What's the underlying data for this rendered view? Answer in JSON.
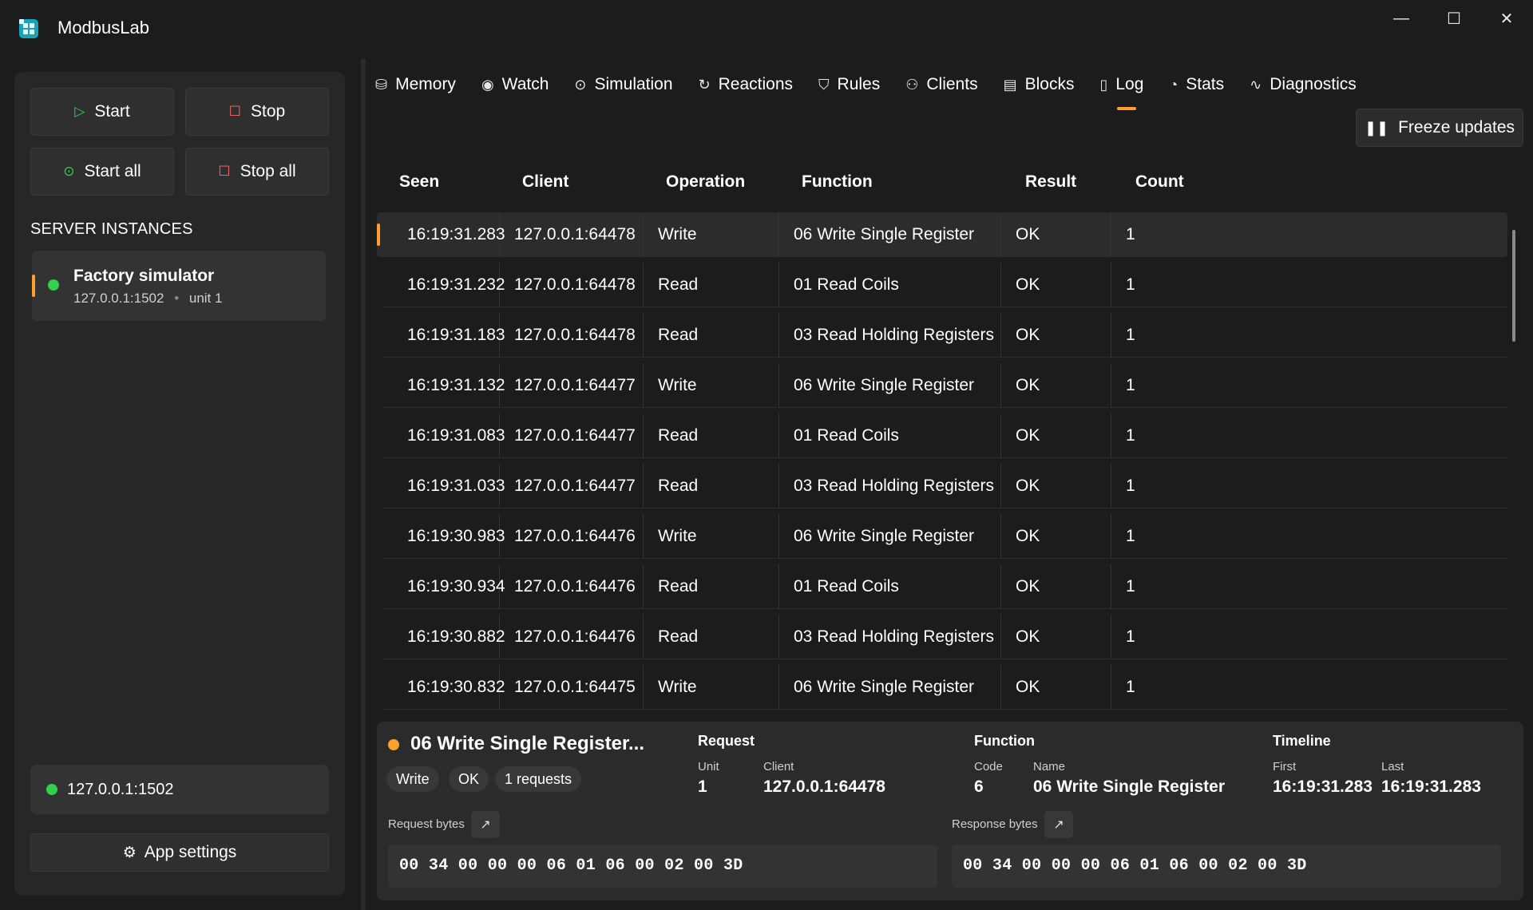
{
  "app": {
    "title": "ModbusLab",
    "window_controls": {
      "minimize": "—",
      "maximize": "☐",
      "close": "✕"
    }
  },
  "sidebar": {
    "buttons": {
      "start": "Start",
      "stop": "Stop",
      "start_all": "Start all",
      "stop_all": "Stop all"
    },
    "section_title": "SERVER INSTANCES",
    "instances": [
      {
        "name": "Factory simulator",
        "address": "127.0.0.1:1502",
        "unit": "unit 1",
        "status_color": "#2fd24a"
      }
    ],
    "status_address": "127.0.0.1:1502",
    "app_settings": "App settings"
  },
  "tabs": [
    {
      "label": "Memory",
      "icon": "database-icon"
    },
    {
      "label": "Watch",
      "icon": "eye-icon"
    },
    {
      "label": "Simulation",
      "icon": "play-circle-icon"
    },
    {
      "label": "Reactions",
      "icon": "refresh-icon"
    },
    {
      "label": "Rules",
      "icon": "shield-icon"
    },
    {
      "label": "Clients",
      "icon": "users-icon"
    },
    {
      "label": "Blocks",
      "icon": "blocks-icon"
    },
    {
      "label": "Log",
      "icon": "document-icon",
      "active": true
    },
    {
      "label": "Stats",
      "icon": "chart-icon"
    },
    {
      "label": "Diagnostics",
      "icon": "pulse-icon"
    }
  ],
  "freeze_updates": "Freeze updates",
  "table": {
    "columns": [
      "Seen",
      "Client",
      "Operation",
      "Function",
      "Result",
      "Count"
    ],
    "rows": [
      [
        "16:19:31.283",
        "127.0.0.1:64478",
        "Write",
        "06 Write Single Register",
        "OK",
        "1"
      ],
      [
        "16:19:31.232",
        "127.0.0.1:64478",
        "Read",
        "01 Read Coils",
        "OK",
        "1"
      ],
      [
        "16:19:31.183",
        "127.0.0.1:64478",
        "Read",
        "03 Read Holding Registers",
        "OK",
        "1"
      ],
      [
        "16:19:31.132",
        "127.0.0.1:64477",
        "Write",
        "06 Write Single Register",
        "OK",
        "1"
      ],
      [
        "16:19:31.083",
        "127.0.0.1:64477",
        "Read",
        "01 Read Coils",
        "OK",
        "1"
      ],
      [
        "16:19:31.033",
        "127.0.0.1:64477",
        "Read",
        "03 Read Holding Registers",
        "OK",
        "1"
      ],
      [
        "16:19:30.983",
        "127.0.0.1:64476",
        "Write",
        "06 Write Single Register",
        "OK",
        "1"
      ],
      [
        "16:19:30.934",
        "127.0.0.1:64476",
        "Read",
        "01 Read Coils",
        "OK",
        "1"
      ],
      [
        "16:19:30.882",
        "127.0.0.1:64476",
        "Read",
        "03 Read Holding Registers",
        "OK",
        "1"
      ],
      [
        "16:19:30.832",
        "127.0.0.1:64475",
        "Write",
        "06 Write Single Register",
        "OK",
        "1"
      ]
    ]
  },
  "details": {
    "title": "06 Write Single Register...",
    "chips": [
      "Write",
      "OK",
      "1 requests"
    ],
    "request": {
      "heading": "Request",
      "unit_label": "Unit",
      "unit": "1",
      "client_label": "Client",
      "client": "127.0.0.1:64478"
    },
    "function": {
      "heading": "Function",
      "code_label": "Code",
      "code": "6",
      "name_label": "Name",
      "name": "06 Write Single Register"
    },
    "timeline": {
      "heading": "Timeline",
      "first_label": "First",
      "first": "16:19:31.283",
      "last_label": "Last",
      "last": "16:19:31.283"
    },
    "request_bytes_label": "Request bytes",
    "request_bytes": "00 34 00 00 00 06 01 06 00 02 00 3D",
    "response_bytes_label": "Response bytes",
    "response_bytes": "00 34 00 00 00 06 01 06 00 02 00 3D"
  },
  "colors": {
    "accent": "#ff9f2e",
    "running": "#2fd24a",
    "stopped": "#ff6b6b",
    "background": "#1c1c1c"
  }
}
